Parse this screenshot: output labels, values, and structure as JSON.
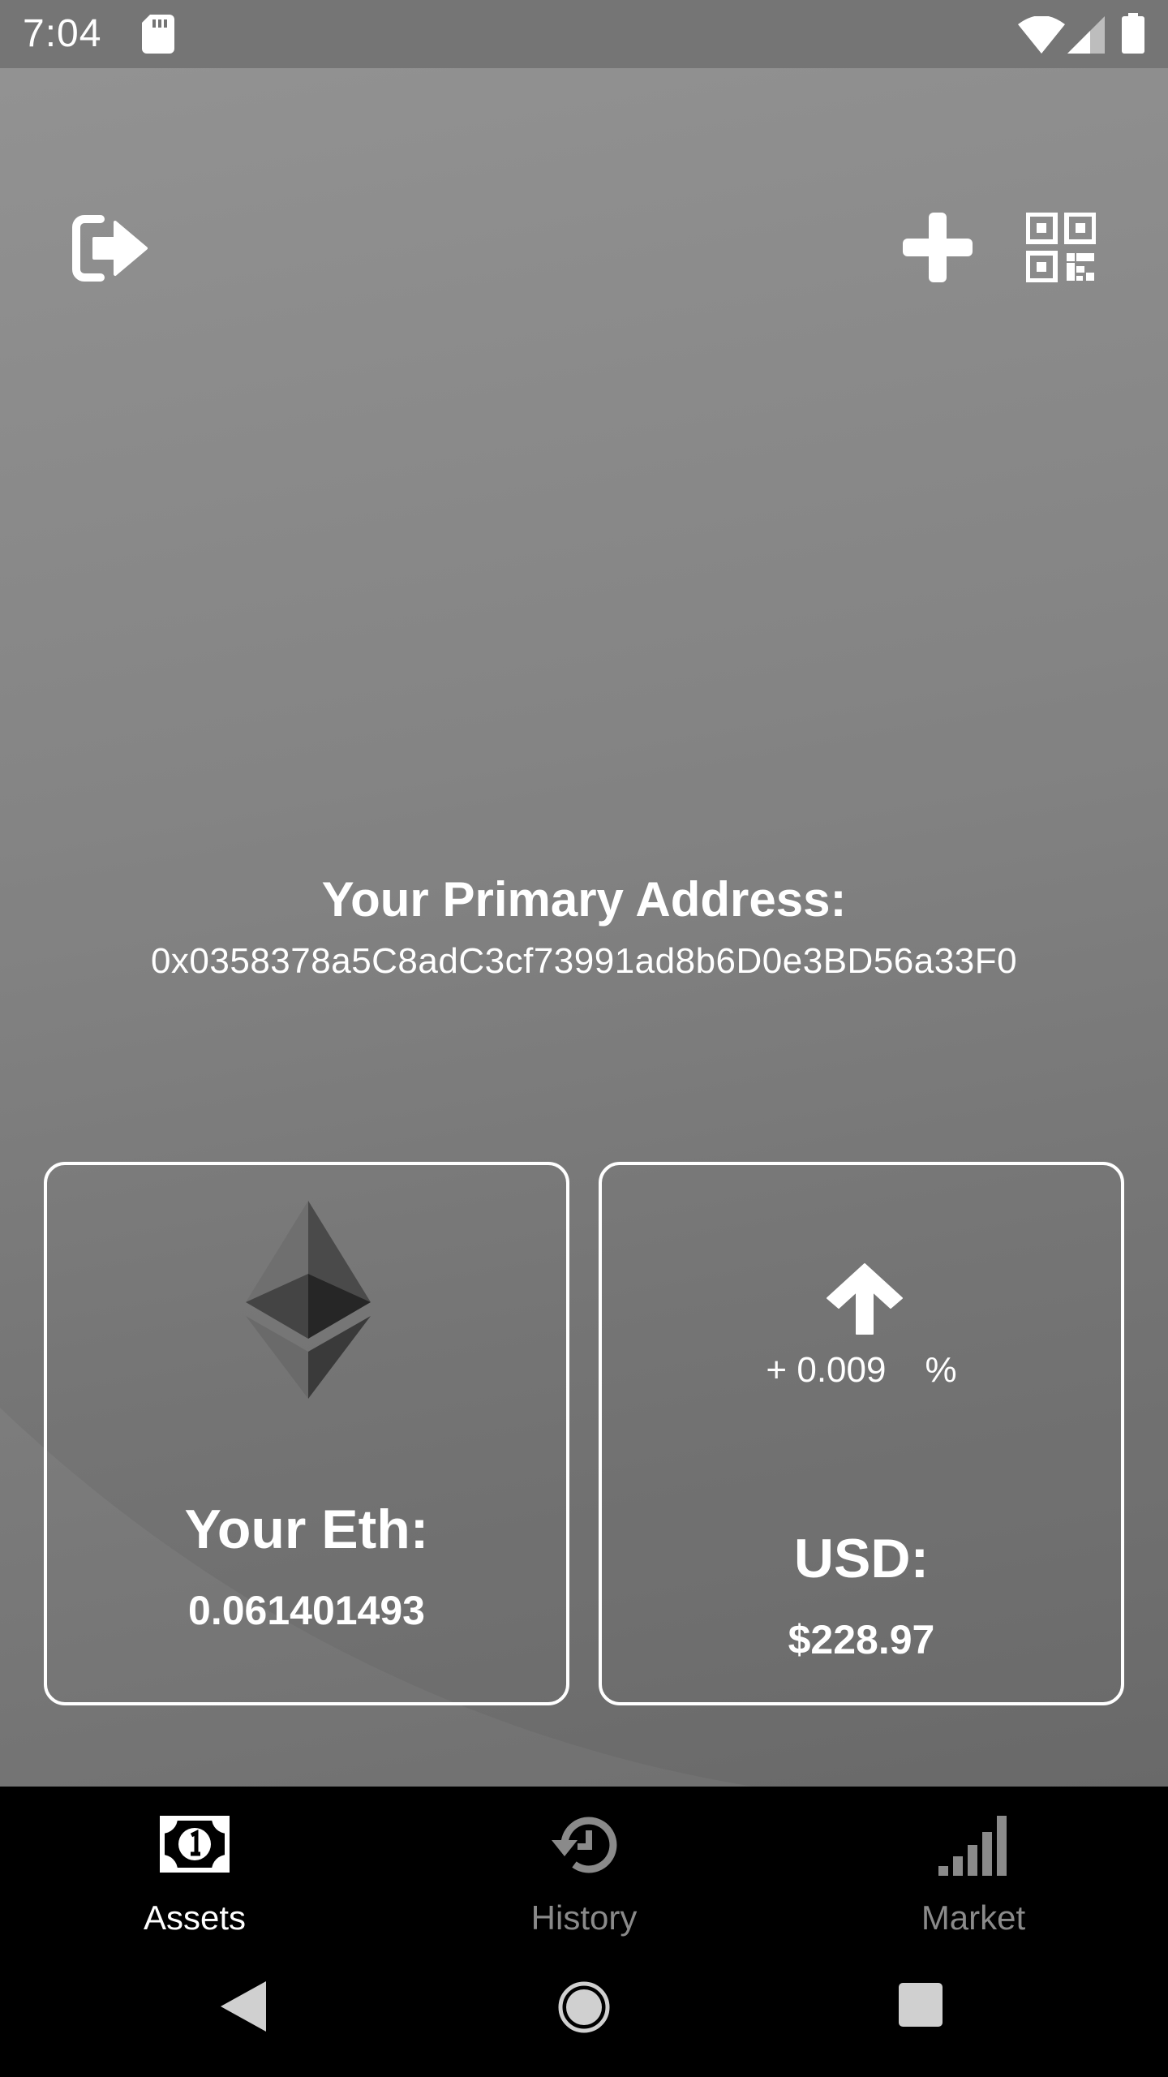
{
  "status_bar": {
    "time": "7:04",
    "icons": [
      "sd-card-icon",
      "wifi-icon",
      "signal-icon",
      "battery-icon"
    ]
  },
  "toolbar": {
    "icons": [
      "logout-icon",
      "plus-icon",
      "qr-code-icon"
    ]
  },
  "address": {
    "title": "Your Primary Address:",
    "value": "0x0358378a5C8adC3cf73991ad8b6D0e3BD56a33F0"
  },
  "eth_card": {
    "icon": "ethereum-icon",
    "label": "Your Eth:",
    "value": "0.061401493"
  },
  "usd_card": {
    "icon": "arrow-up-icon",
    "change": "+ 0.009",
    "change_unit": "%",
    "label": "USD:",
    "value": "$228.97"
  },
  "bottom_nav": {
    "items": [
      {
        "label": "Assets",
        "icon": "money-icon",
        "active": true
      },
      {
        "label": "History",
        "icon": "history-icon",
        "active": false
      },
      {
        "label": "Market",
        "icon": "signal-bars-icon",
        "active": false
      }
    ]
  },
  "colors": {
    "status_bar": "#757575",
    "background_top": "#9a9a9a",
    "background_bottom": "#6f6f6f",
    "nav_background": "#000000",
    "nav_active": "#ffffff",
    "nav_inactive": "#8a8a8a"
  }
}
